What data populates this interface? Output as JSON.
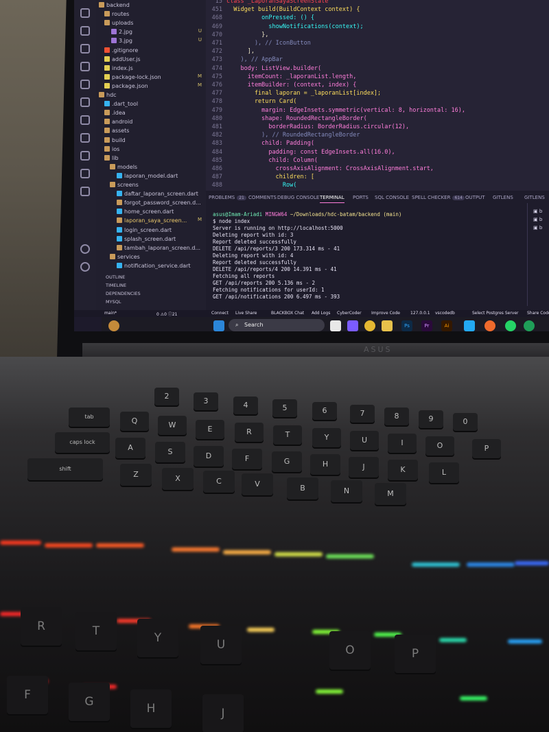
{
  "explorer": {
    "items": [
      {
        "label": "backend",
        "badge": ""
      },
      {
        "label": "routes",
        "badge": ""
      },
      {
        "label": "uploads",
        "badge": ""
      },
      {
        "label": "2.jpg",
        "badge": "U"
      },
      {
        "label": "3.jpg",
        "badge": "U"
      },
      {
        "label": ".gitignore",
        "badge": ""
      },
      {
        "label": "addUser.js",
        "badge": ""
      },
      {
        "label": "index.js",
        "badge": ""
      },
      {
        "label": "package-lock.json",
        "badge": "M"
      },
      {
        "label": "package.json",
        "badge": "M"
      },
      {
        "label": "hdc",
        "badge": ""
      },
      {
        "label": ".dart_tool",
        "badge": ""
      },
      {
        "label": ".idea",
        "badge": ""
      },
      {
        "label": "android",
        "badge": ""
      },
      {
        "label": "assets",
        "badge": ""
      },
      {
        "label": "build",
        "badge": ""
      },
      {
        "label": "ios",
        "badge": ""
      },
      {
        "label": "lib",
        "badge": ""
      },
      {
        "label": "models",
        "badge": ""
      },
      {
        "label": "laporan_model.dart",
        "badge": ""
      },
      {
        "label": "screens",
        "badge": ""
      },
      {
        "label": "daftar_laporan_screen.dart",
        "badge": ""
      },
      {
        "label": "forgot_password_screen.d...",
        "badge": ""
      },
      {
        "label": "home_screen.dart",
        "badge": ""
      },
      {
        "label": "laporan_saya_screen...",
        "badge": "M"
      },
      {
        "label": "login_screen.dart",
        "badge": ""
      },
      {
        "label": "splash_screen.dart",
        "badge": ""
      },
      {
        "label": "tambah_laporan_screen.d...",
        "badge": ""
      },
      {
        "label": "services",
        "badge": ""
      },
      {
        "label": "notification_service.dart",
        "badge": ""
      }
    ],
    "sections": [
      "OUTLINE",
      "TIMELINE",
      "DEPENDENCIES",
      "MYSQL"
    ]
  },
  "editor": {
    "line_numbers": [
      "15",
      "451",
      "468",
      "469",
      "470",
      "471",
      "472",
      "473",
      "474",
      "475",
      "476",
      "477",
      "478",
      "479",
      "480",
      "481",
      "482",
      "483",
      "484",
      "485",
      "486",
      "487",
      "488"
    ],
    "lines": [
      "class _LaporanSayaScreenState",
      "  Widget build(BuildContext context) {",
      "          onPressed: () {",
      "            showNotifications(context);",
      "          },",
      "        ), // IconButton",
      "      ],",
      "    ), // AppBar",
      "    body: ListView.builder(",
      "      itemCount: _laporanList.length,",
      "      itemBuilder: (context, index) {",
      "        final laporan = _laporanList[index];",
      "        return Card(",
      "          margin: EdgeInsets.symmetric(vertical: 8, horizontal: 16),",
      "          shape: RoundedRectangleBorder(",
      "            borderRadius: BorderRadius.circular(12),",
      "          ), // RoundedRectangleBorder",
      "          child: Padding(",
      "            padding: const EdgeInsets.all(16.0),",
      "            child: Column(",
      "              crossAxisAlignment: CrossAxisAlignment.start,",
      "              children: [",
      "                Row("
    ]
  },
  "panel": {
    "tabs": [
      {
        "label": "PROBLEMS",
        "count": "21"
      },
      {
        "label": "COMMENTS",
        "count": ""
      },
      {
        "label": "DEBUG CONSOLE",
        "count": ""
      },
      {
        "label": "TERMINAL",
        "count": ""
      },
      {
        "label": "PORTS",
        "count": ""
      },
      {
        "label": "SQL CONSOLE",
        "count": ""
      },
      {
        "label": "SPELL CHECKER",
        "count": "614"
      },
      {
        "label": "OUTPUT",
        "count": ""
      },
      {
        "label": "GITLENS",
        "count": ""
      },
      {
        "label": "GITLENS",
        "count": ""
      }
    ],
    "terminal": {
      "prompt_user": "asus@Imam-Ariadi",
      "prompt_env": "MINGW64",
      "prompt_path": "~/Downloads/hdc-batam/backend (main)",
      "command": "$ node index",
      "output": [
        "Server is running on http://localhost:5000",
        "Deleting report with id: 3",
        "Report deleted successfully",
        "DELETE /api/reports/3 200 173.314 ms - 41",
        "Deleting report with id: 4",
        "Report deleted successfully",
        "DELETE /api/reports/4 200 14.391 ms - 41",
        "Fetching all reports",
        "GET /api/reports 200 5.136 ms - 2",
        "Fetching notifications for userId: 1",
        "GET /api/notifications 200 6.497 ms - 393"
      ]
    }
  },
  "status_bar": {
    "branch": "main*",
    "problems": "0 ⚠0 ⓘ21",
    "items": [
      "Connect",
      "Live Share",
      "BLACKBOX Chat",
      "Add Logs",
      "CyberCoder",
      "Improve Code",
      "127.0.0.1",
      "vscodedb",
      "Select Postgres Server",
      "Share Code"
    ]
  },
  "taskbar": {
    "search_label": "Search",
    "apps": [
      "Ps",
      "Pr",
      "Ai"
    ]
  },
  "keyboard": {
    "keys": [
      "2",
      "3",
      "4",
      "5",
      "6",
      "7",
      "8",
      "9",
      "0",
      "tab",
      "Q",
      "W",
      "E",
      "R",
      "T",
      "Y",
      "U",
      "I",
      "O",
      "P",
      "caps lock",
      "A",
      "S",
      "D",
      "F",
      "G",
      "H",
      "J",
      "K",
      "L",
      "shift",
      "Z",
      "X",
      "C",
      "V",
      "B",
      "N",
      "M",
      "R",
      "T",
      "Y",
      "U",
      "O",
      "P",
      "F",
      "G",
      "H",
      "J"
    ]
  }
}
